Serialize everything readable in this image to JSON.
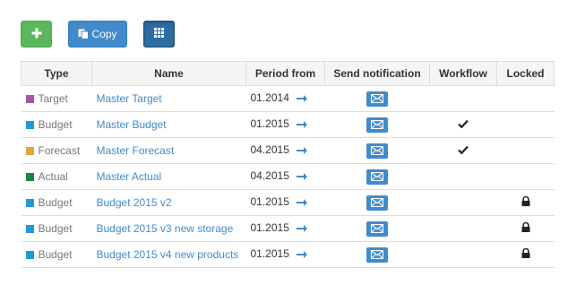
{
  "toolbar": {
    "add_icon": "plus-icon",
    "copy_label": "Copy",
    "copy_icon": "copy-icon",
    "grid_icon": "grid-icon"
  },
  "table": {
    "headers": [
      "Type",
      "Name",
      "Period from",
      "Send notification",
      "Workflow",
      "Locked"
    ],
    "rows": [
      {
        "type": "Target",
        "color": "#a05a9f",
        "name": "Master Target",
        "period": "01.2014",
        "workflow": false,
        "locked": false
      },
      {
        "type": "Budget",
        "color": "#1f9bd1",
        "name": "Master Budget",
        "period": "01.2015",
        "workflow": true,
        "locked": false
      },
      {
        "type": "Forecast",
        "color": "#e6a23c",
        "name": "Master Forecast",
        "period": "04.2015",
        "workflow": true,
        "locked": false
      },
      {
        "type": "Actual",
        "color": "#1a8a3a",
        "name": "Master Actual",
        "period": "04.2015",
        "workflow": false,
        "locked": false
      },
      {
        "type": "Budget",
        "color": "#1f9bd1",
        "name": "Budget 2015 v2",
        "period": "01.2015",
        "workflow": false,
        "locked": true
      },
      {
        "type": "Budget",
        "color": "#1f9bd1",
        "name": "Budget 2015 v3 new storage",
        "period": "01.2015",
        "workflow": false,
        "locked": true
      },
      {
        "type": "Budget",
        "color": "#1f9bd1",
        "name": "Budget 2015 v4 new products",
        "period": "01.2015",
        "workflow": false,
        "locked": true
      }
    ]
  },
  "icons": {
    "arrow": "arrow-right-icon",
    "mail": "envelope-icon",
    "check": "checkmark-icon",
    "lock": "lock-icon"
  },
  "colors": {
    "add_button": "#5cb85c",
    "primary": "#428bca",
    "grid_button_active": "#2e6da4"
  }
}
